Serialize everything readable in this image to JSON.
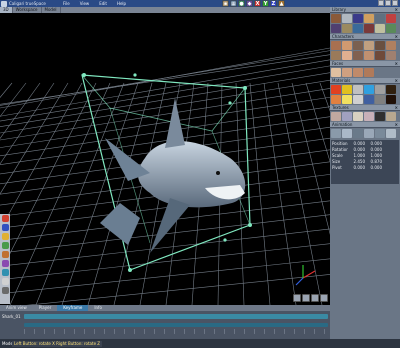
{
  "window": {
    "title": "Caligari trueSpace"
  },
  "menu": [
    "File",
    "View",
    "Edit",
    "Help"
  ],
  "toolbar_icons": [
    {
      "glyph": "▣",
      "color": "#8a6a3a",
      "name": "render-icon"
    },
    {
      "glyph": "▦",
      "color": "#4a6a8a",
      "name": "grid-icon"
    },
    {
      "glyph": "●",
      "color": "#3a8a5a",
      "name": "sphere-icon"
    },
    {
      "glyph": "◆",
      "color": "#6a4a9a",
      "name": "material-icon"
    },
    {
      "glyph": "X",
      "color": "#c03030",
      "name": "x-axis-icon"
    },
    {
      "glyph": "Y",
      "color": "#30a030",
      "name": "y-axis-icon"
    },
    {
      "glyph": "Z",
      "color": "#3040c0",
      "name": "z-axis-icon"
    },
    {
      "glyph": "▲",
      "color": "#a07030",
      "name": "light-icon"
    }
  ],
  "viewport_tabs": [
    {
      "label": "3D",
      "active": true
    },
    {
      "label": "Workspace",
      "active": false
    },
    {
      "label": "Model",
      "active": false
    }
  ],
  "panel": {
    "sections": [
      {
        "title": "Library",
        "swatches": [
          "#8a5a3a",
          "#b0b8c0",
          "#3a3a8a",
          "#d0a060",
          "#607080",
          "#c04040",
          "#504070",
          "#9a8a60",
          "#3a6a9a",
          "#7a3a3a",
          "#c0c0a0",
          "#5a8a5a"
        ]
      },
      {
        "title": "Characters",
        "swatches": [
          "#a87050",
          "#d09a70",
          "#7a6050",
          "#c0a080",
          "#6a5040",
          "#b08060",
          "#9a7a5a",
          "#e0b090",
          "#806050",
          "#c09070",
          "#704a3a",
          "#a08070"
        ]
      },
      {
        "title": "Faces",
        "swatches": [
          "#e0c0a0",
          "#d0a080",
          "#c08a6a",
          "#b07a5a"
        ]
      },
      {
        "title": "Materials",
        "swatches": [
          "#e04020",
          "#e0c020",
          "#c0c0c0",
          "#30a0e0",
          "#a0a0a0",
          "#302010",
          "#e08040",
          "#f0e060",
          "#d0d0d0",
          "#4060a0",
          "#808080",
          "#201008"
        ]
      },
      {
        "title": "Textures",
        "swatches": [
          "#c0a8a0",
          "#a0a0c0",
          "#d8d0c0",
          "#c8b0b8",
          "#303030",
          "#b8a890"
        ]
      },
      {
        "title": "Animation",
        "swatches": [
          "#8a9aaa",
          "#aab8c8",
          "#6a7a8a",
          "#9aa8b8",
          "#7a8a9a",
          "#b0bcc8"
        ]
      }
    ],
    "properties": [
      {
        "k": "Position",
        "a": "0.000",
        "b": "0.000"
      },
      {
        "k": "Rotation",
        "a": "0.000",
        "b": "0.000"
      },
      {
        "k": "Scale",
        "a": "1.000",
        "b": "1.000"
      },
      {
        "k": "Size",
        "a": "2.450",
        "b": "0.870"
      },
      {
        "k": "Pivot",
        "a": "0.000",
        "b": "0.000"
      }
    ]
  },
  "timeline": {
    "tabs": [
      {
        "label": "Anim view",
        "active": false
      },
      {
        "label": "Player",
        "active": false
      },
      {
        "label": "Keyframe",
        "active": true
      },
      {
        "label": "Info",
        "active": false
      }
    ],
    "track_label": "Shark_01"
  },
  "status": {
    "mode": "Model",
    "hint": "Left Button: rotate X  Right Button: rotate Z"
  }
}
